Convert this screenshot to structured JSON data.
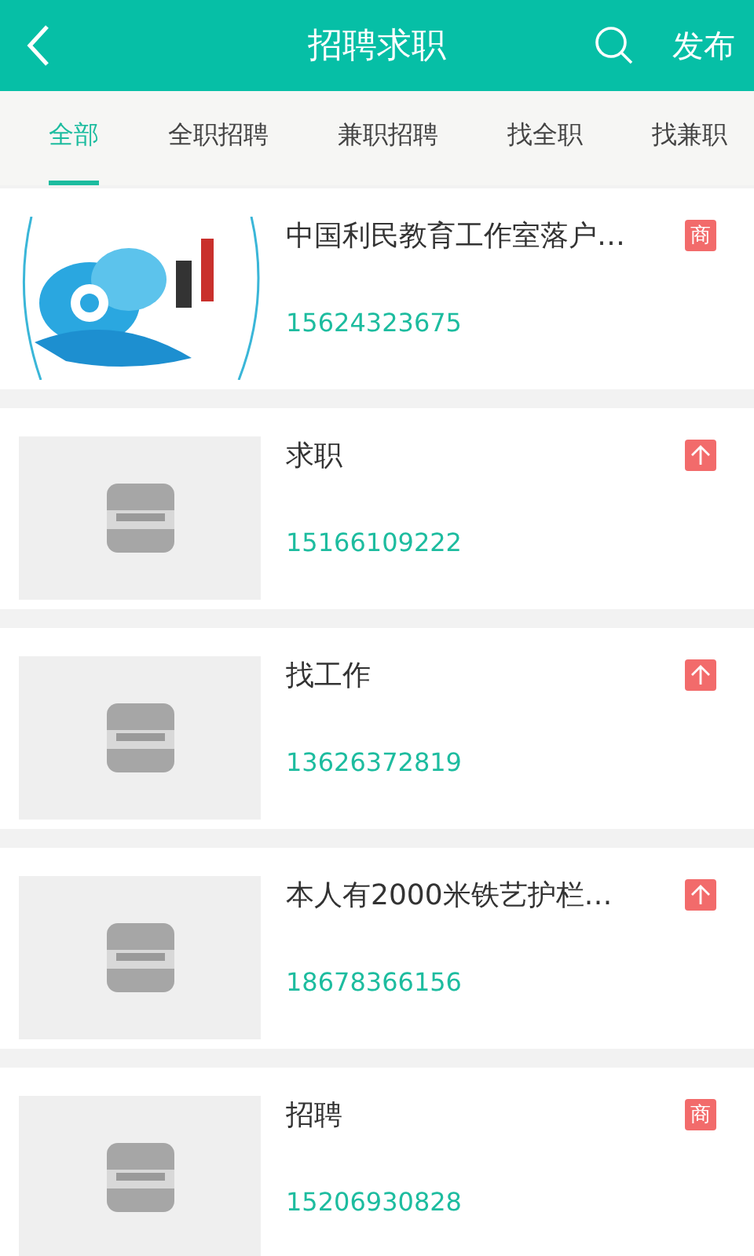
{
  "header": {
    "title": "招聘求职",
    "action": "发布"
  },
  "tabs": [
    {
      "label": "全部",
      "selected": true
    },
    {
      "label": "全职招聘",
      "selected": false
    },
    {
      "label": "兼职招聘",
      "selected": false
    },
    {
      "label": "找全职",
      "selected": false
    },
    {
      "label": "找兼职",
      "selected": false
    }
  ],
  "listings": [
    {
      "image": {
        "kind": "logo"
      },
      "title": "中国利民教育工作室落户…",
      "phone": "15624323675",
      "badge": {
        "kind": "text",
        "text": "商"
      }
    },
    {
      "image": {
        "kind": "placeholder"
      },
      "title": "求职",
      "phone": "15166109222",
      "badge": {
        "kind": "top"
      }
    },
    {
      "image": {
        "kind": "placeholder"
      },
      "title": "找工作",
      "phone": "13626372819",
      "badge": {
        "kind": "top"
      }
    },
    {
      "image": {
        "kind": "placeholder"
      },
      "title": "本人有2000米铁艺护栏…",
      "phone": "18678366156",
      "badge": {
        "kind": "top"
      }
    },
    {
      "image": {
        "kind": "placeholder"
      },
      "title": "招聘",
      "phone": "15206930828",
      "badge": {
        "kind": "text",
        "text": "商"
      }
    }
  ]
}
